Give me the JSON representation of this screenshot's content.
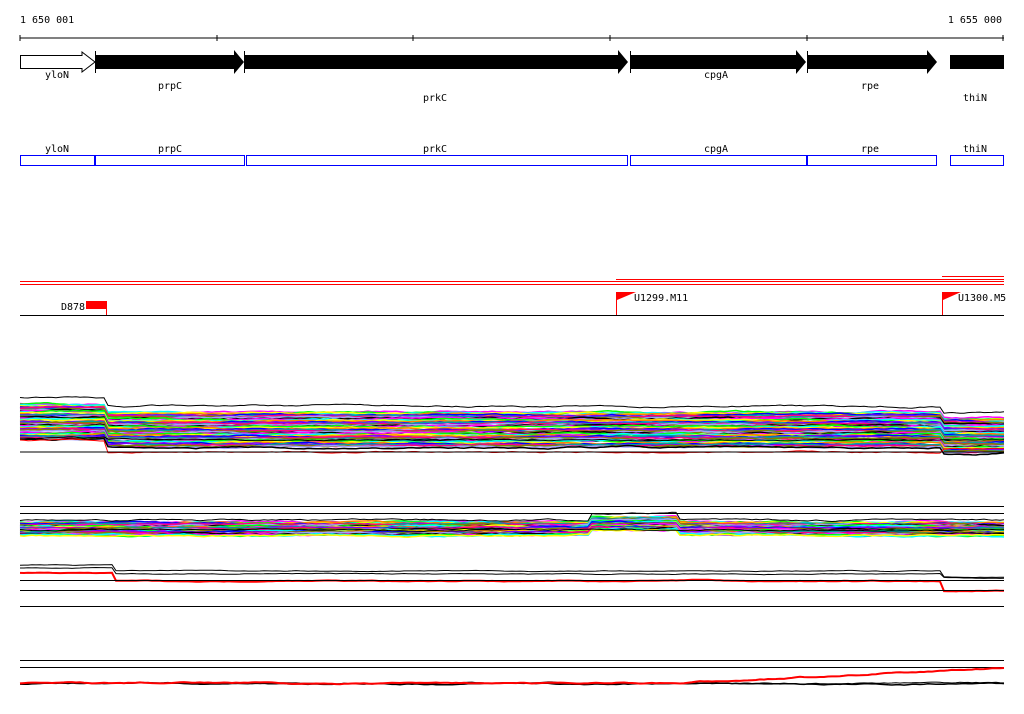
{
  "ruler": {
    "start_label": "1 650 001",
    "end_label": "1 655 000"
  },
  "genes": [
    {
      "name": "yloN",
      "filled": false
    },
    {
      "name": "prpC",
      "filled": true
    },
    {
      "name": "prkC",
      "filled": true
    },
    {
      "name": "cpgA",
      "filled": true
    },
    {
      "name": "rpe",
      "filled": true
    },
    {
      "name": "thiN",
      "filled": true
    }
  ],
  "feature_boxes": [
    "yloN",
    "prpC",
    "prkC",
    "cpgA",
    "rpe",
    "thiN"
  ],
  "markers": [
    {
      "label": "D878"
    },
    {
      "label": "U1299.M11"
    },
    {
      "label": "U1300.M5"
    }
  ],
  "colors": {
    "gene_box": "#0000ff",
    "marker": "#ff0000",
    "line": "#000000"
  }
}
